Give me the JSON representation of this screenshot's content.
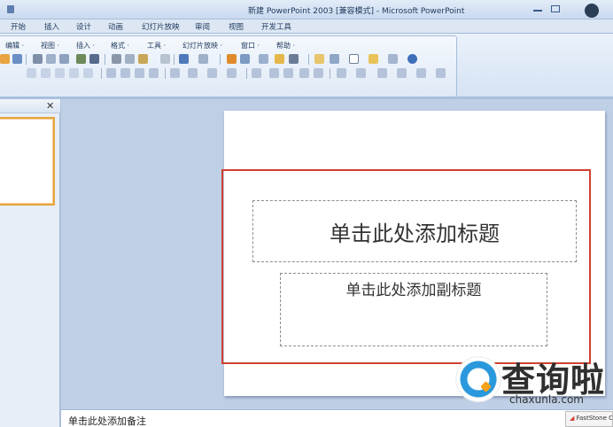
{
  "window": {
    "title": "新建 PowerPoint 2003 [兼容模式] - Microsoft PowerPoint"
  },
  "tabs": [
    "开始",
    "插入",
    "设计",
    "动画",
    "幻灯片放映",
    "审阅",
    "视图",
    "开发工具"
  ],
  "classic_menu": {
    "items": [
      "编辑 ·",
      "视图 ·",
      "插入 ·",
      "格式 ·",
      "工具 ·",
      "幻灯片放映 ·",
      "窗口 ·",
      "帮助 ·"
    ]
  },
  "slides_panel": {
    "close_glyph": "✕"
  },
  "slide": {
    "title_placeholder": "单击此处添加标题",
    "subtitle_placeholder": "单击此处添加副标题"
  },
  "notes": {
    "placeholder": "单击此处添加备注"
  },
  "watermark": {
    "brand": "查询啦",
    "url": "chaxunla.com"
  },
  "badge": {
    "text": "FastStone C"
  },
  "colors": {
    "highlight_box": "#d0412f",
    "thumb_border": "#e5a440"
  }
}
